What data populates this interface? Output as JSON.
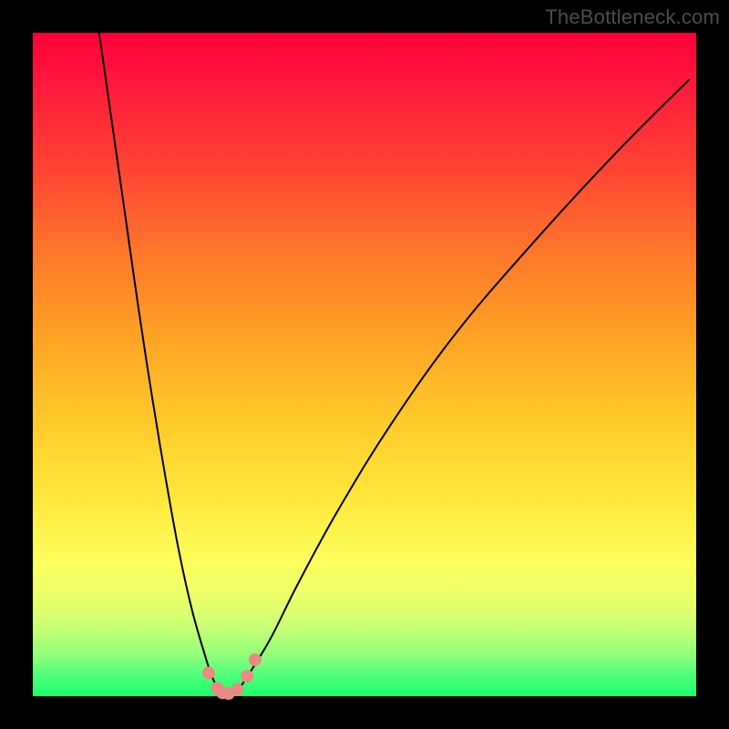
{
  "watermark": "TheBottleneck.com",
  "colors": {
    "frame": "#000000",
    "curve": "#000000",
    "marker": "#eb8a82",
    "gradient_top": "#ff003a",
    "gradient_bottom": "#1dff6e"
  },
  "chart_data": {
    "type": "line",
    "title": "",
    "xlabel": "",
    "ylabel": "",
    "xlim": [
      0,
      100
    ],
    "ylim": [
      0,
      100
    ],
    "grid": false,
    "series": [
      {
        "name": "left_curve",
        "x": [
          10,
          12,
          14,
          16,
          18,
          20,
          22,
          24,
          26,
          27,
          28,
          29
        ],
        "y": [
          100,
          86,
          72,
          58,
          45,
          33,
          22,
          13,
          6,
          3,
          1,
          0
        ]
      },
      {
        "name": "right_curve",
        "x": [
          30,
          31,
          33,
          36,
          40,
          46,
          54,
          64,
          76,
          88,
          99
        ],
        "y": [
          0,
          1,
          4,
          9,
          17,
          28,
          41,
          55,
          69,
          82,
          93
        ]
      }
    ],
    "markers": [
      {
        "x": 26.5,
        "y": 3.5
      },
      {
        "x": 27.8,
        "y": 1.2
      },
      {
        "x": 28.6,
        "y": 0.5
      },
      {
        "x": 29.5,
        "y": 0.4
      },
      {
        "x": 30.8,
        "y": 1.0
      },
      {
        "x": 32.3,
        "y": 3.0
      },
      {
        "x": 33.5,
        "y": 5.5
      }
    ]
  }
}
